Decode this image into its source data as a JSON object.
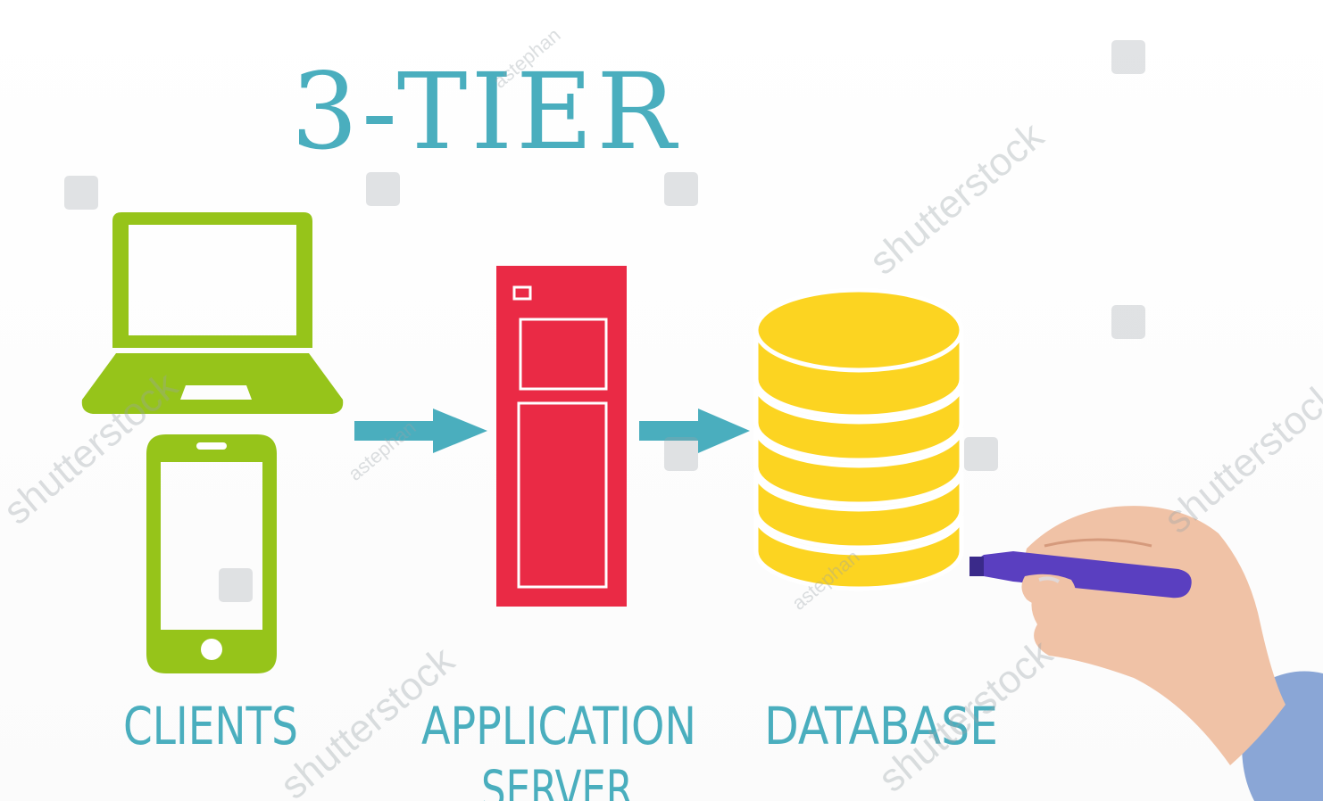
{
  "title": "3-TIER",
  "tiers": [
    {
      "label": "CLIENTS",
      "icons": [
        "laptop-icon",
        "smartphone-icon"
      ]
    },
    {
      "label_line1": "APPLICATION",
      "label_line2": "SERVER",
      "icons": [
        "server-icon"
      ]
    },
    {
      "label": "DATABASE",
      "icons": [
        "database-icon"
      ]
    }
  ],
  "connections": [
    {
      "from": "CLIENTS",
      "to": "APPLICATION SERVER"
    },
    {
      "from": "APPLICATION SERVER",
      "to": "DATABASE"
    }
  ],
  "watermarks": {
    "brand": "shutterstock",
    "author": "astephan"
  },
  "colors": {
    "title": "#4aaebe",
    "labels": "#4aaebe",
    "arrows": "#4aaebe",
    "clients": "#96c41a",
    "server": "#ea2a45",
    "database": "#fcd421",
    "marker": "#5a3fc0"
  }
}
